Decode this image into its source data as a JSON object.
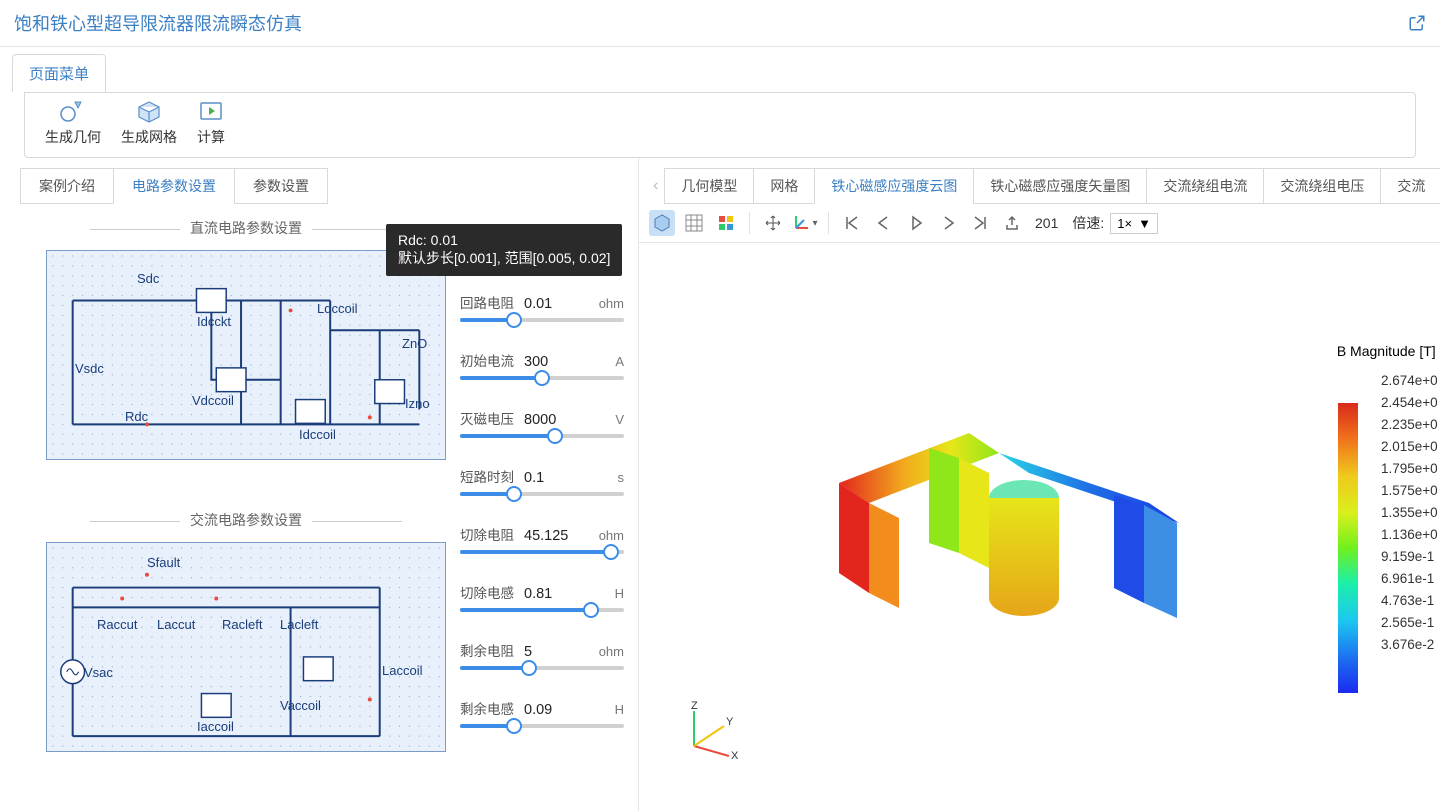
{
  "header": {
    "title": "饱和铁心型超导限流器限流瞬态仿真",
    "open_icon": "open-in-new"
  },
  "menubar": {
    "menu_label": "页面菜单"
  },
  "toolbar": {
    "buttons": [
      {
        "id": "geom",
        "label": "生成几何",
        "icon": "droplet"
      },
      {
        "id": "mesh",
        "label": "生成网格",
        "icon": "cube"
      },
      {
        "id": "compute",
        "label": "计算",
        "icon": "play"
      }
    ]
  },
  "left_tabs": {
    "items": [
      {
        "label": "案例介绍",
        "active": false
      },
      {
        "label": "电路参数设置",
        "active": true
      },
      {
        "label": "参数设置",
        "active": false
      }
    ]
  },
  "dc_section": {
    "title": "直流电路参数设置",
    "labels": [
      "Sdc",
      "Idcckt",
      "Ldccoil",
      "ZnO",
      "Vsdc",
      "Vdccoil",
      "Idccoil",
      "Izno",
      "Rdc"
    ]
  },
  "ac_section": {
    "title": "交流电路参数设置",
    "labels": [
      "Sfault",
      "Raccut",
      "Laccut",
      "Racleft",
      "Lacleft",
      "Vsac",
      "Iaccoil",
      "Vaccoil",
      "Laccoil"
    ]
  },
  "tooltip": {
    "line1": "Rdc: 0.01",
    "line2": "默认步长[0.001], 范围[0.005, 0.02]"
  },
  "params": [
    {
      "label": "回路电阻",
      "value": "0.01",
      "unit": "ohm",
      "fill": 33
    },
    {
      "label": "初始电流",
      "value": "300",
      "unit": "A",
      "fill": 50
    },
    {
      "label": "灭磁电压",
      "value": "8000",
      "unit": "V",
      "fill": 58
    },
    {
      "label": "短路时刻",
      "value": "0.1",
      "unit": "s",
      "fill": 33
    },
    {
      "label": "切除电阻",
      "value": "45.125",
      "unit": "ohm",
      "fill": 92
    },
    {
      "label": "切除电感",
      "value": "0.81",
      "unit": "H",
      "fill": 80
    },
    {
      "label": "剩余电阻",
      "value": "5",
      "unit": "ohm",
      "fill": 42
    },
    {
      "label": "剩余电感",
      "value": "0.09",
      "unit": "H",
      "fill": 33
    }
  ],
  "right_tabs": {
    "items": [
      {
        "label": "几何模型",
        "active": false
      },
      {
        "label": "网格",
        "active": false
      },
      {
        "label": "铁心磁感应强度云图",
        "active": true
      },
      {
        "label": "铁心磁感应强度矢量图",
        "active": false
      },
      {
        "label": "交流绕组电流",
        "active": false
      },
      {
        "label": "交流绕组电压",
        "active": false
      },
      {
        "label": "交流",
        "active": false
      }
    ]
  },
  "vis_toolbar": {
    "frame": "201",
    "speed_label": "倍速:",
    "speed_value": "1×"
  },
  "legend": {
    "title": "B Magnitude [T]",
    "ticks": [
      "2.674e+0",
      "2.454e+0",
      "2.235e+0",
      "2.015e+0",
      "1.795e+0",
      "1.575e+0",
      "1.355e+0",
      "1.136e+0",
      "9.159e-1",
      "6.961e-1",
      "4.763e-1",
      "2.565e-1",
      "3.676e-2"
    ]
  },
  "axis": {
    "x": "X",
    "y": "Y",
    "z": "Z"
  },
  "colors": {
    "accent": "#3b7fc4",
    "slider": "#3b8de8"
  }
}
